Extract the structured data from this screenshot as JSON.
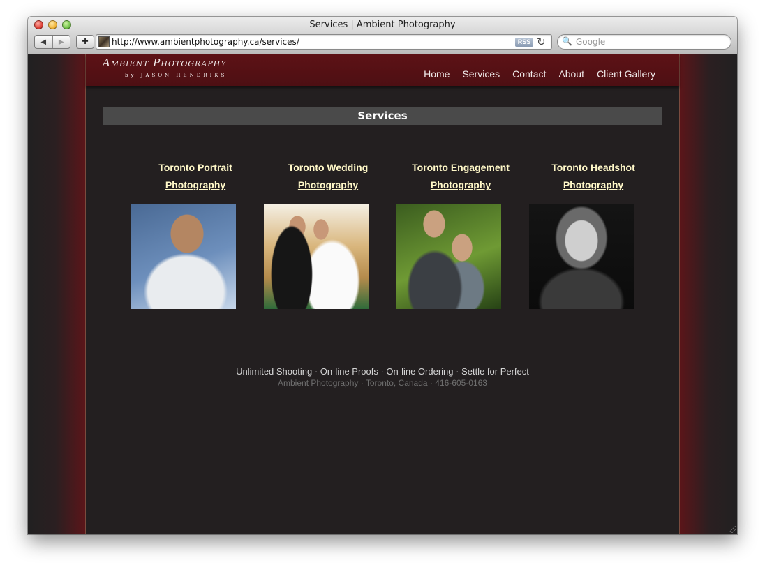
{
  "window": {
    "title": "Services | Ambient Photography",
    "back_icon": "◀",
    "forward_icon": "▶",
    "add_icon": "+",
    "url": "http://www.ambientphotography.ca/services/",
    "rss_label": "RSS",
    "reload_icon": "↻",
    "search_icon": "🔍",
    "search_placeholder": "Google"
  },
  "site": {
    "logo_title": "Ambient Photography",
    "logo_byline": "by JASON HENDRIKS",
    "nav": [
      "Home",
      "Services",
      "Contact",
      "About",
      "Client Gallery"
    ]
  },
  "section_title": "Services",
  "services": [
    {
      "line1": "Toronto Portrait",
      "line2": "Photography"
    },
    {
      "line1": "Toronto Wedding",
      "line2": "Photography"
    },
    {
      "line1": "Toronto Engagement",
      "line2": "Photography"
    },
    {
      "line1": "Toronto Headshot",
      "line2": "Photography"
    }
  ],
  "footer": {
    "tagline": "Unlimited Shooting · On-line Proofs · On-line Ordering · Settle for Perfect",
    "contact": "Ambient Photography · Toronto, Canada · 416-605-0163"
  },
  "colors": {
    "page_bg": "#231f20",
    "header_bg": "#5d1216",
    "link_color": "#fff8c8",
    "section_bar": "#4a4a4a"
  }
}
